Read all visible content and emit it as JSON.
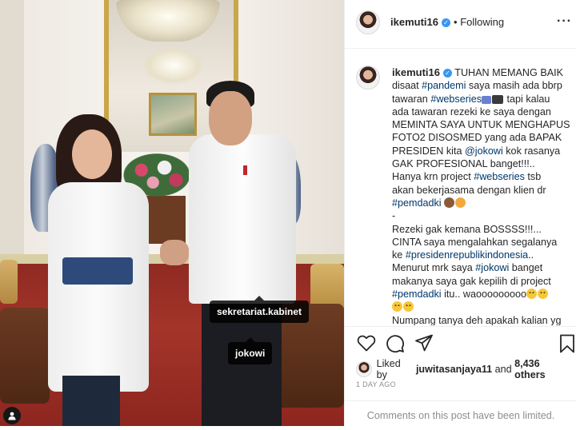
{
  "photo": {
    "tags": [
      "sekretariat.kabinet",
      "jokowi"
    ],
    "user_tags_icon": "person-icon"
  },
  "header": {
    "username": "ikemuti16",
    "verified_icon": "verified-badge-icon",
    "separator": "•",
    "follow_status": "Following",
    "more_icon": "more-options-icon"
  },
  "caption": {
    "username": "ikemuti16",
    "lines": [
      [
        {
          "t": "TUHAN MEMANG BAIK"
        }
      ],
      [
        {
          "t": "disaat "
        },
        {
          "t": "#pandemi",
          "h": 1
        },
        {
          "t": " saya masih ada bbrp"
        }
      ],
      [
        {
          "t": "tawaran "
        },
        {
          "t": "#webseries",
          "h": 1
        },
        {
          "e": "tv"
        },
        {
          "e": "cam"
        },
        {
          "t": " tapi kalau"
        }
      ],
      [
        {
          "t": "ada tawaran rezeki ke saya dengan"
        }
      ],
      [
        {
          "t": "MEMINTA SAYA UNTUK MENGHAPUS"
        }
      ],
      [
        {
          "t": "FOTO2 DISOSMED yang ada BAPAK"
        }
      ],
      [
        {
          "t": "PRESIDEN kita "
        },
        {
          "t": "@jokowi",
          "h": 1
        },
        {
          "t": " kok rasanya"
        }
      ],
      [
        {
          "t": "GAK PROFESIONAL banget!!!.."
        }
      ],
      [
        {
          "t": "Hanya krn project "
        },
        {
          "t": "#webseries",
          "h": 1
        },
        {
          "t": " tsb"
        }
      ],
      [
        {
          "t": "akan bekerjasama dengan klien dr"
        }
      ],
      [
        {
          "t": "#pemdadki",
          "h": 1
        },
        {
          "t": " "
        },
        {
          "e": "m"
        },
        {
          "e": "c"
        }
      ],
      [
        {
          "t": "-"
        }
      ],
      [
        {
          "t": "Rezeki gak kemana BOSSSS!!!..."
        }
      ],
      [
        {
          "t": "CINTA saya mengalahkan segalanya"
        }
      ],
      [
        {
          "t": "ke "
        },
        {
          "t": "#presidenrepublikindonesia",
          "h": 1
        },
        {
          "t": ".."
        }
      ],
      [
        {
          "t": "Menurut mrk saya "
        },
        {
          "t": "#jokowi",
          "h": 1
        },
        {
          "t": " banget"
        }
      ],
      [
        {
          "t": "makanya saya gak kepilih di project"
        }
      ],
      [
        {
          "t": "#pemdadki",
          "h": 1
        },
        {
          "t": " itu.. waooooooooo"
        },
        {
          "e": "y"
        },
        {
          "e": "y"
        }
      ],
      [
        {
          "e": "y"
        },
        {
          "e": "y"
        }
      ],
      [
        {
          "t": "Numpang tanya deh apakah kalian yg"
        }
      ]
    ]
  },
  "actions": {
    "like_icon": "heart-icon",
    "comment_icon": "comment-icon",
    "share_icon": "share-icon",
    "save_icon": "bookmark-icon"
  },
  "likes": {
    "prefix": "Liked by ",
    "user": "juwitasanjaya11",
    "middle": " and ",
    "others": "8,436 others"
  },
  "date": "1 DAY AGO",
  "comments_notice": "Comments on this post have been limited."
}
